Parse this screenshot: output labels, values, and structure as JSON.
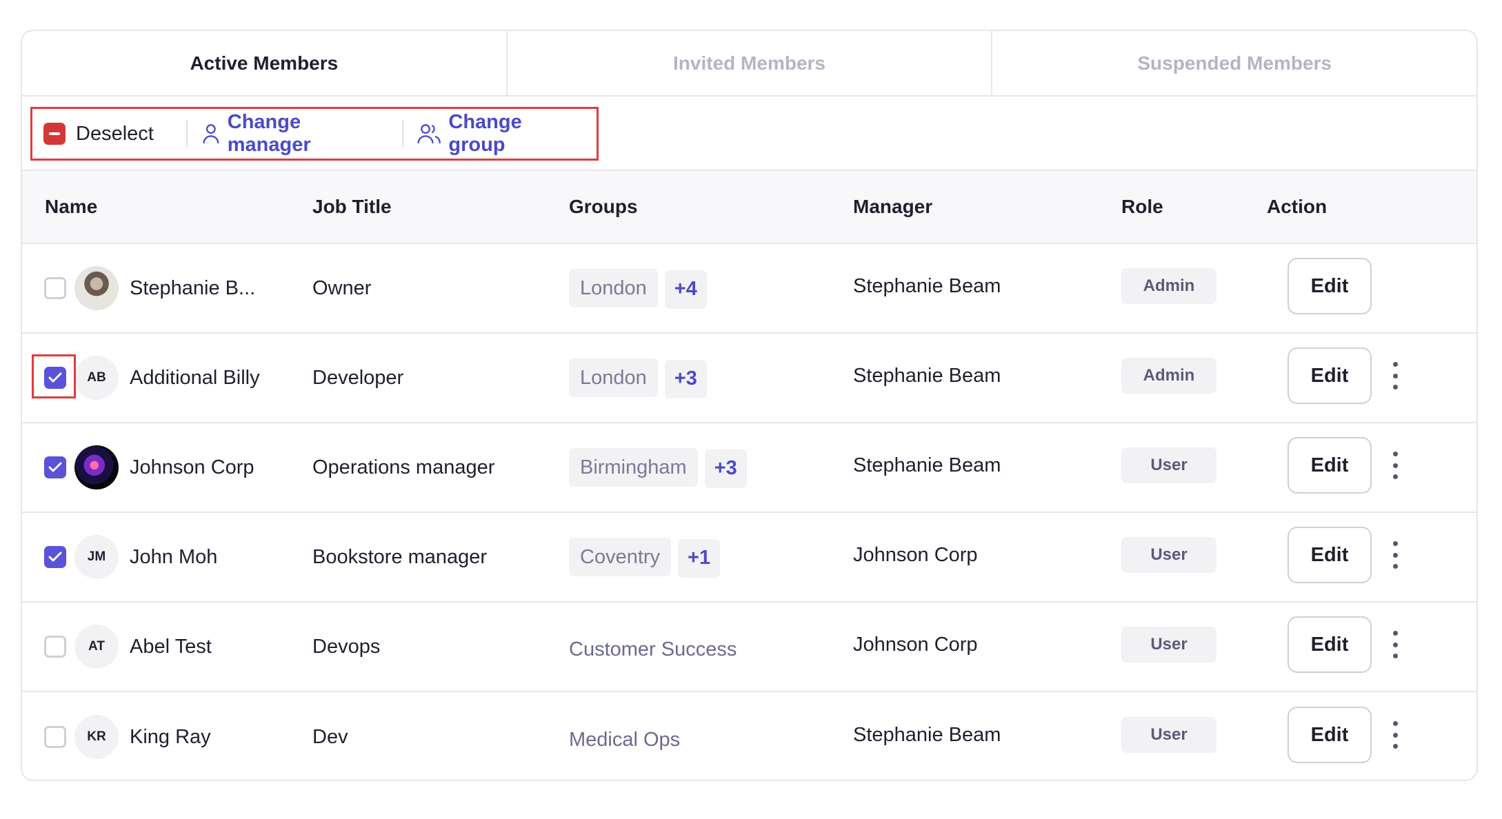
{
  "tabs": [
    {
      "label": "Active Members"
    },
    {
      "label": "Invited Members"
    },
    {
      "label": "Suspended Members"
    }
  ],
  "toolbar": {
    "deselect_label": "Deselect",
    "change_manager_label": "Change manager",
    "change_group_label": "Change group"
  },
  "columns": {
    "name": "Name",
    "job_title": "Job Title",
    "groups": "Groups",
    "manager": "Manager",
    "role": "Role",
    "action": "Action"
  },
  "rows": [
    {
      "checked": false,
      "avatar": "photo",
      "initials": "",
      "name": "Stephanie B...",
      "job_title": "Owner",
      "group": "London",
      "group_more": "+4",
      "manager": "Stephanie Beam",
      "role": "Admin",
      "edit_label": "Edit",
      "has_menu": false
    },
    {
      "checked": true,
      "avatar": "initials",
      "initials": "AB",
      "name": "Additional Billy",
      "job_title": "Developer",
      "group": "London",
      "group_more": "+3",
      "manager": "Stephanie Beam",
      "role": "Admin",
      "edit_label": "Edit",
      "has_menu": true
    },
    {
      "checked": true,
      "avatar": "photo",
      "initials": "",
      "name": "Johnson Corp",
      "job_title": "Operations manager",
      "group": "Birmingham",
      "group_more": "+3",
      "manager": "Stephanie Beam",
      "role": "User",
      "edit_label": "Edit",
      "has_menu": true
    },
    {
      "checked": true,
      "avatar": "initials",
      "initials": "JM",
      "name": "John Moh",
      "job_title": "Bookstore manager",
      "group": "Coventry",
      "group_more": "+1",
      "manager": "Johnson Corp",
      "role": "User",
      "edit_label": "Edit",
      "has_menu": true
    },
    {
      "checked": false,
      "avatar": "initials",
      "initials": "AT",
      "name": "Abel Test",
      "job_title": "Devops",
      "group": "Customer Success",
      "group_more": "",
      "manager": "Johnson Corp",
      "role": "User",
      "edit_label": "Edit",
      "has_menu": true
    },
    {
      "checked": false,
      "avatar": "initials",
      "initials": "KR",
      "name": "King Ray",
      "job_title": "Dev",
      "group": "Medical Ops",
      "group_more": "",
      "manager": "Stephanie Beam",
      "role": "User",
      "edit_label": "Edit",
      "has_menu": true
    }
  ],
  "colors": {
    "accent": "#5a52d8",
    "link": "#4a4ac7",
    "deselect": "#d43737",
    "highlight": "#e23b3b"
  }
}
